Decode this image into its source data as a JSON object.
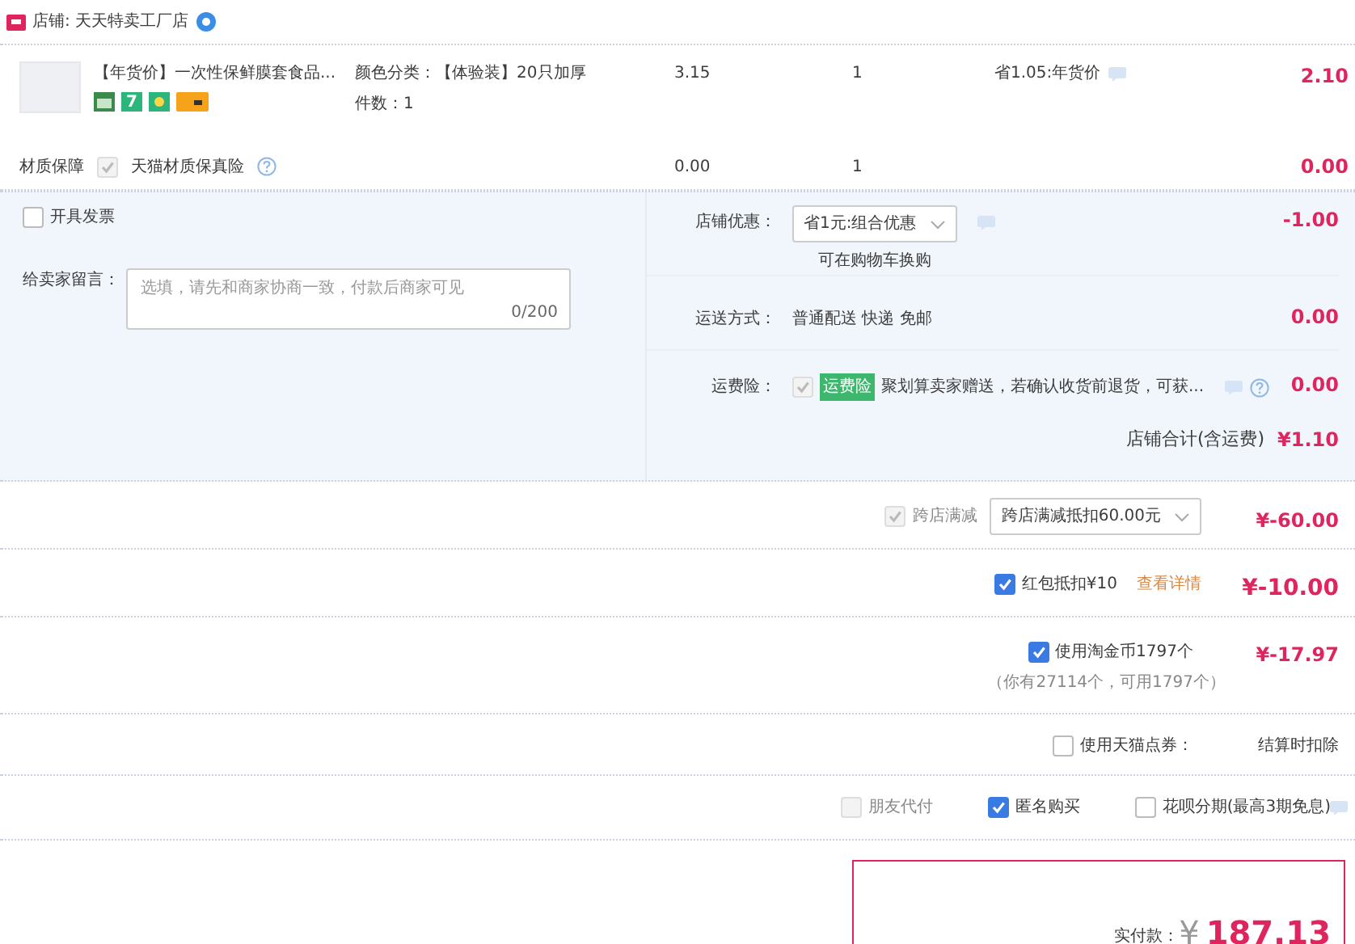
{
  "store": {
    "label": "店铺: 天天特卖工厂店"
  },
  "item": {
    "title": "【年货价】一次性保鲜膜套食品...",
    "return_badge": "7",
    "spec": "颜色分类：【体验装】20只加厚",
    "quantity_label": "件数：1",
    "price": "3.15",
    "quantity": "1",
    "promo": "省1.05:年货价",
    "total": "2.10"
  },
  "insurance": {
    "label": "材质保障",
    "checked": true,
    "disabled": true,
    "name": "天猫材质保真险",
    "price": "0.00",
    "quantity": "1",
    "total": "0.00"
  },
  "invoice": {
    "label": "开具发票",
    "checked": false
  },
  "message": {
    "label": "给卖家留言：",
    "placeholder": "选填，请先和商家协商一致，付款后商家可见",
    "counter": "0/200"
  },
  "store_discount": {
    "label": "店铺优惠：",
    "value": "省1元:组合优惠",
    "note": "可在购物车换购",
    "amount": "-1.00"
  },
  "shipping": {
    "label": "运送方式：",
    "value": "普通配送 快递 免邮",
    "amount": "0.00"
  },
  "shipping_insurance": {
    "label": "运费险：",
    "checked": true,
    "disabled": true,
    "tag": "运费险",
    "text": "聚划算卖家赠送，若确认收货前退货，可获...",
    "amount": "0.00"
  },
  "store_total": {
    "label": "店铺合计(含运费)",
    "amount": "¥1.10"
  },
  "discounts": [
    {
      "kind": "select",
      "label": "跨店满减",
      "checked": true,
      "disabled": true,
      "value": "跨店满减抵扣60.00元",
      "amount": "¥-60.00"
    },
    {
      "kind": "link",
      "label": "红包抵扣¥10",
      "checked": true,
      "disabled": false,
      "link": "查看详情",
      "amount": "¥-10.00"
    },
    {
      "kind": "note",
      "label": "使用淘金币1797个",
      "checked": true,
      "disabled": false,
      "note": "（你有27114个，可用1797个）",
      "amount": "¥-17.97"
    },
    {
      "kind": "text",
      "label": "使用天猫点券：",
      "checked": false,
      "disabled": false,
      "value": "结算时扣除"
    }
  ],
  "options": [
    {
      "label": "朋友代付",
      "checked": false,
      "disabled": true
    },
    {
      "label": "匿名购买",
      "checked": true,
      "disabled": false
    },
    {
      "label": "花呗分期(最高3期免息)",
      "checked": false,
      "disabled": false
    }
  ],
  "payment": {
    "label": "实付款：",
    "currency": "¥",
    "amount": "187.13"
  }
}
